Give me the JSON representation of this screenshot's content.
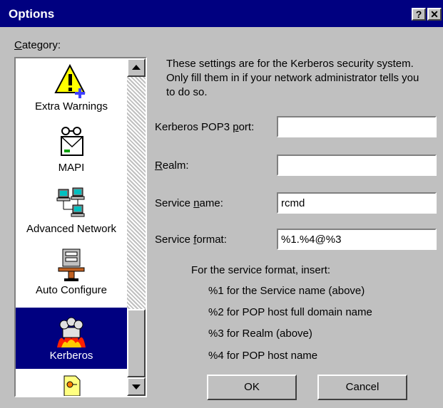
{
  "window": {
    "title": "Options",
    "help_glyph": "?",
    "close_glyph": "✕"
  },
  "category": {
    "label_ul": "C",
    "label_rest": "ategory:",
    "items": [
      {
        "label": "Extra Warnings",
        "icon": "warning-icon"
      },
      {
        "label": "MAPI",
        "icon": "mapi-icon"
      },
      {
        "label": "Advanced Network",
        "icon": "network-icon"
      },
      {
        "label": "Auto Configure",
        "icon": "auto-configure-icon"
      },
      {
        "label": "Kerberos",
        "icon": "kerberos-icon",
        "selected": true
      },
      {
        "label": "",
        "icon": "certificate-icon"
      }
    ]
  },
  "description": "These settings are for the Kerberos security system. Only fill them in if your network administrator tells you to do so.",
  "fields": {
    "pop3_port": {
      "label_pre": "Kerberos POP3 ",
      "label_ul": "p",
      "label_post": "ort:",
      "value": ""
    },
    "realm": {
      "label_pre": "",
      "label_ul": "R",
      "label_post": "ealm:",
      "value": ""
    },
    "service_name": {
      "label_pre": "Service ",
      "label_ul": "n",
      "label_post": "ame:",
      "value": "rcmd"
    },
    "service_format": {
      "label_pre": "Service ",
      "label_ul": "f",
      "label_post": "ormat:",
      "value": "%1.%4@%3"
    }
  },
  "hint": {
    "heading": "For the service format, insert:",
    "lines": [
      "%1 for the Service name (above)",
      "%2 for POP host full domain name",
      "%3 for Realm (above)",
      "%4 for POP host name"
    ]
  },
  "buttons": {
    "ok": "OK",
    "cancel": "Cancel"
  },
  "colors": {
    "titlebar": "#000080",
    "face": "#c0c0c0",
    "selection": "#000080"
  }
}
